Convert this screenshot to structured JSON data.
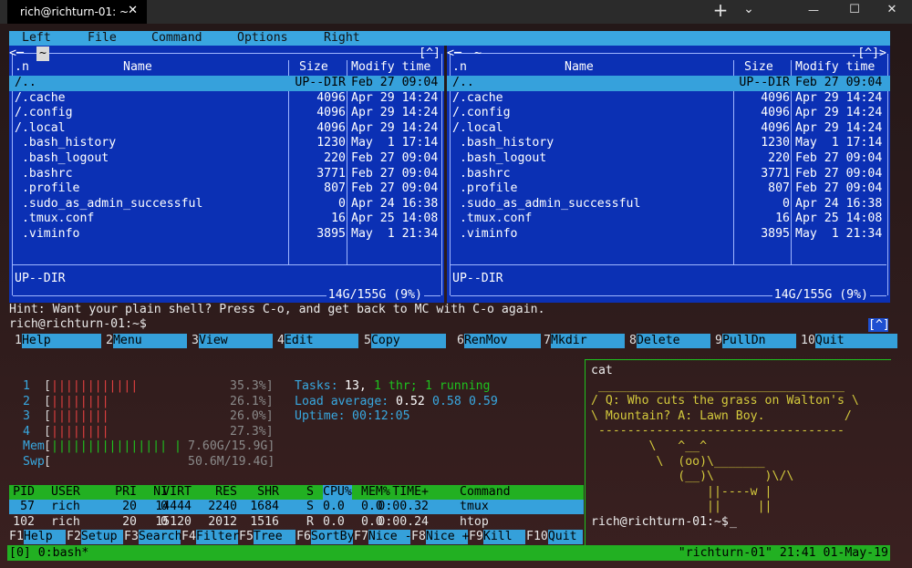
{
  "window": {
    "tab_title": "rich@richturn-01: ~",
    "tab_close": "✕",
    "new_tab": "+",
    "dropdown": "⌄",
    "minimize": "—",
    "maximize": "☐",
    "close": "✕"
  },
  "mc": {
    "menu": [
      "Left",
      "File",
      "Command",
      "Options",
      "Right"
    ],
    "left_panel": {
      "path": "~",
      "hotkey": "[^]",
      "columns": {
        "name_hint": ".n",
        "name": "Name",
        "size": "Size",
        "modify": "Modify time"
      },
      "rows": [
        {
          "name": "/..",
          "size": "UP--DIR",
          "date": "Feb 27 09:04"
        },
        {
          "name": "/.cache",
          "size": "4096",
          "date": "Apr 29 14:24"
        },
        {
          "name": "/.config",
          "size": "4096",
          "date": "Apr 29 14:24"
        },
        {
          "name": "/.local",
          "size": "4096",
          "date": "Apr 29 14:24"
        },
        {
          "name": " .bash_history",
          "size": "1230",
          "date": "May  1 17:14"
        },
        {
          "name": " .bash_logout",
          "size": "220",
          "date": "Feb 27 09:04"
        },
        {
          "name": " .bashrc",
          "size": "3771",
          "date": "Feb 27 09:04"
        },
        {
          "name": " .profile",
          "size": "807",
          "date": "Feb 27 09:04"
        },
        {
          "name": " .sudo_as_admin_successful",
          "size": "0",
          "date": "Apr 24 16:38"
        },
        {
          "name": " .tmux.conf",
          "size": "16",
          "date": "Apr 25 14:08"
        },
        {
          "name": " .viminfo",
          "size": "3895",
          "date": "May  1 21:34"
        }
      ],
      "status": "UP--DIR",
      "disk": "14G/155G (9%)"
    },
    "right_panel": {
      "path": "~",
      "hotkey": ".[^]>",
      "columns": {
        "name_hint": ".n",
        "name": "Name",
        "size": "Size",
        "modify": "Modify time"
      },
      "rows": [
        {
          "name": "/..",
          "size": "UP--DIR",
          "date": "Feb 27 09:04"
        },
        {
          "name": "/.cache",
          "size": "4096",
          "date": "Apr 29 14:24"
        },
        {
          "name": "/.config",
          "size": "4096",
          "date": "Apr 29 14:24"
        },
        {
          "name": "/.local",
          "size": "4096",
          "date": "Apr 29 14:24"
        },
        {
          "name": " .bash_history",
          "size": "1230",
          "date": "May  1 17:14"
        },
        {
          "name": " .bash_logout",
          "size": "220",
          "date": "Feb 27 09:04"
        },
        {
          "name": " .bashrc",
          "size": "3771",
          "date": "Feb 27 09:04"
        },
        {
          "name": " .profile",
          "size": "807",
          "date": "Feb 27 09:04"
        },
        {
          "name": " .sudo_as_admin_successful",
          "size": "0",
          "date": "Apr 24 16:38"
        },
        {
          "name": " .tmux.conf",
          "size": "16",
          "date": "Apr 25 14:08"
        },
        {
          "name": " .viminfo",
          "size": "3895",
          "date": "May  1 21:34"
        }
      ],
      "status": "UP--DIR",
      "disk": "14G/155G (9%)"
    },
    "hint": "Hint: Want your plain shell? Press C-o, and get back to MC with C-o again.",
    "prompt": "rich@richturn-01:~$",
    "scroll_hotkey": "[^]",
    "fkeys": [
      {
        "n": "1",
        "l": "Help"
      },
      {
        "n": "2",
        "l": "Menu"
      },
      {
        "n": "3",
        "l": "View"
      },
      {
        "n": "4",
        "l": "Edit"
      },
      {
        "n": "5",
        "l": "Copy"
      },
      {
        "n": "6",
        "l": "RenMov"
      },
      {
        "n": "7",
        "l": "Mkdir"
      },
      {
        "n": "8",
        "l": "Delete"
      },
      {
        "n": "9",
        "l": "PullDn"
      },
      {
        "n": "10",
        "l": "Quit"
      }
    ]
  },
  "htop": {
    "cpus": [
      {
        "id": "1",
        "bar": "||||||||||||",
        "pct": "35.3%]"
      },
      {
        "id": "2",
        "bar": "||||||||",
        "pct": "26.1%]"
      },
      {
        "id": "3",
        "bar": "||||||||",
        "pct": "26.0%]"
      },
      {
        "id": "4",
        "bar": "||||||||",
        "pct": "27.3%]"
      }
    ],
    "mem": {
      "label": "Mem",
      "bar": "|||||||||||||||| |",
      "value": "7.60G/15.9G]"
    },
    "swp": {
      "label": "Swp",
      "value": "50.6M/19.4G]"
    },
    "tasks_label": "Tasks:",
    "tasks_count": "13,",
    "thr": "1 thr;",
    "running": "1 running",
    "load_label": "Load average:",
    "load1": "0.52",
    "load5": "0.58",
    "load15": "0.59",
    "uptime_label": "Uptime:",
    "uptime": "00:12:05",
    "header": {
      "pid": "PID",
      "user": "USER",
      "pri": "PRI",
      "ni": "NI",
      "virt": "VIRT",
      "res": "RES",
      "shr": "SHR",
      "s": "S",
      "cpu": "CPU%",
      "mem": "MEM%",
      "time": "TIME+",
      "cmd": "Command"
    },
    "processes": [
      {
        "pid": "57",
        "user": "rich",
        "pri": "20",
        "ni": "0",
        "virt": "14444",
        "res": "2240",
        "shr": "1684",
        "s": "S",
        "cpu": "0.0",
        "mem": "0.0",
        "time": "0:00.32",
        "cmd": "tmux"
      },
      {
        "pid": "102",
        "user": "rich",
        "pri": "20",
        "ni": "0",
        "virt": "15120",
        "res": "2012",
        "shr": "1516",
        "s": "R",
        "cpu": "0.0",
        "mem": "0.0",
        "time": "0:00.24",
        "cmd": "htop"
      }
    ],
    "fkeys": [
      {
        "n": "F1",
        "l": "Help"
      },
      {
        "n": "F2",
        "l": "Setup"
      },
      {
        "n": "F3",
        "l": "Search"
      },
      {
        "n": "F4",
        "l": "Filter"
      },
      {
        "n": "F5",
        "l": "Tree"
      },
      {
        "n": "F6",
        "l": "SortBy"
      },
      {
        "n": "F7",
        "l": "Nice -"
      },
      {
        "n": "F8",
        "l": "Nice +"
      },
      {
        "n": "F9",
        "l": "Kill"
      },
      {
        "n": "F10",
        "l": "Quit"
      }
    ]
  },
  "cat": {
    "command": "cat",
    "lines": [
      " __________________________________",
      "/ Q: Who cuts the grass on Walton's \\",
      "\\ Mountain? A: Lawn Boy.           /",
      " ----------------------------------",
      "        \\   ^__^",
      "         \\  (oo)\\_______",
      "            (__)\\       )\\/\\",
      "                ||----w |",
      "                ||     ||"
    ],
    "prompt": "rich@richturn-01:~$",
    "cursor": "_"
  },
  "tmux": {
    "left": "[0] 0:bash*",
    "right": "\"richturn-01\" 21:41 01-May-19"
  },
  "colors": {
    "mc_blue": "#0b30b4",
    "mc_cyan": "#36a1dc",
    "htop_green": "#22b022"
  }
}
